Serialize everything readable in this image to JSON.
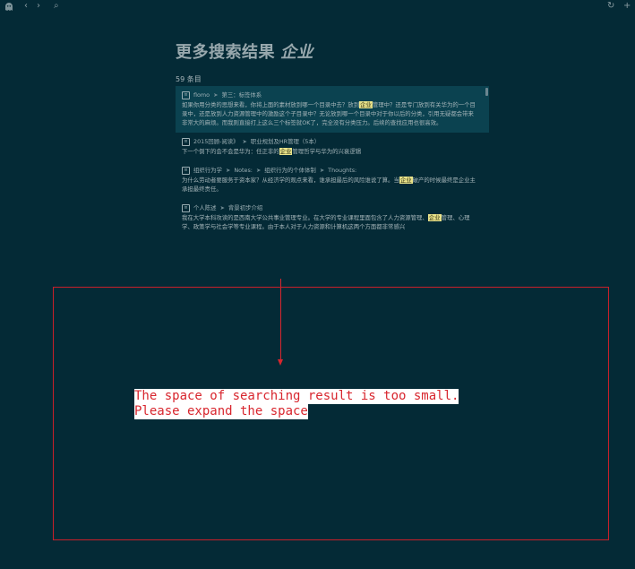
{
  "topbar": {
    "logo_icon": "ghost-logo-icon",
    "back_glyph": "‹",
    "forward_glyph": "›",
    "search_glyph": "⌕",
    "refresh_glyph": "↻",
    "newpage_glyph": "+"
  },
  "header": {
    "title_prefix": "更多搜索结果",
    "title_keyword": "企业"
  },
  "results_count": "59 条目",
  "results": [
    {
      "breadcrumbs": [
        "flomo",
        "第三：标签体系"
      ],
      "snippet_before": "如果你用分类的思想来看，你将上面的素材放到哪一个目录中去？放到",
      "highlight": "企业",
      "snippet_after": "管理中？还是专门放到有关华为的一个目录中，还是放到人力资源管理中的激励这个子目录中？无论放到哪一个目录中对于你以后的分类，引用无疑都会带来非常大的麻烦。而我则直接打上这么三个标签就OK了，完全没有分类压力。后续的查找应用也很高效。"
    },
    {
      "breadcrumbs": [
        "2015回顾-阅读》",
        "职业规划及HR管理（5本）"
      ],
      "snippet_before": "下一个倒下的会不会是华为：任正非的",
      "highlight": "企业",
      "snippet_after": "管理哲学与华为的兴衰逻辑"
    },
    {
      "breadcrumbs": [
        "组织行为学",
        "Notes:",
        "组织行为的个体体制",
        "Thoughts:"
      ],
      "snippet_before": "为什么劳动者要服务于资本家？从经济学的观点来看，谁承担最后的风险谁说了算。当",
      "highlight": "企业",
      "snippet_after": "破产的时候最终是企业主承担最终责任。"
    },
    {
      "breadcrumbs": [
        "个人陈述",
        "背景初步介绍"
      ],
      "snippet_before": "我在大学本科攻读的是西南大学公共事业管理专业。在大学的专业课程里面包含了人力资源管理、",
      "highlight": "企业",
      "snippet_after": "管理、心理学、政策学与社会学等专业课程。由于本人对于人力资源和计算机这两个方面都非常感兴"
    }
  ],
  "annotation": {
    "line1": "The space of searching result is too small.",
    "line2": "Please expand the space",
    "color": "#d8262e"
  }
}
